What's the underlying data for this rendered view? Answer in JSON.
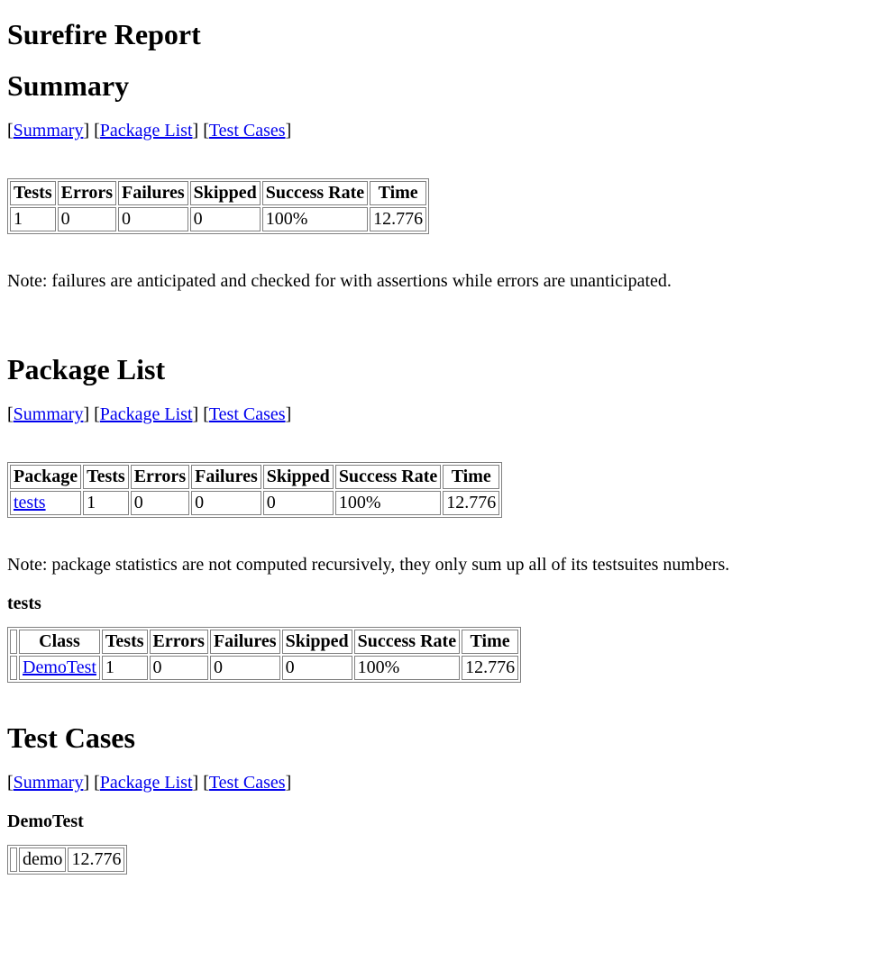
{
  "title": "Surefire Report",
  "sections": {
    "summary": "Summary",
    "packageList": "Package List",
    "testCases": "Test Cases"
  },
  "navLinks": {
    "summary": "Summary",
    "packageList": "Package List",
    "testCases": "Test Cases"
  },
  "summaryTable": {
    "headers": {
      "tests": "Tests",
      "errors": "Errors",
      "failures": "Failures",
      "skipped": "Skipped",
      "successRate": "Success Rate",
      "time": "Time"
    },
    "row": {
      "tests": "1",
      "errors": "0",
      "failures": "0",
      "skipped": "0",
      "successRate": "100%",
      "time": "12.776"
    }
  },
  "summaryNote": "Note: failures are anticipated and checked for with assertions while errors are unanticipated.",
  "packageTable": {
    "headers": {
      "package": "Package",
      "tests": "Tests",
      "errors": "Errors",
      "failures": "Failures",
      "skipped": "Skipped",
      "successRate": "Success Rate",
      "time": "Time"
    },
    "row": {
      "package": "tests",
      "tests": "1",
      "errors": "0",
      "failures": "0",
      "skipped": "0",
      "successRate": "100%",
      "time": "12.776"
    }
  },
  "packageNote": "Note: package statistics are not computed recursively, they only sum up all of its testsuites numbers.",
  "packageSubheading": "tests",
  "classTable": {
    "headers": {
      "blank": "",
      "class": "Class",
      "tests": "Tests",
      "errors": "Errors",
      "failures": "Failures",
      "skipped": "Skipped",
      "successRate": "Success Rate",
      "time": "Time"
    },
    "row": {
      "blank": "",
      "class": "DemoTest",
      "tests": "1",
      "errors": "0",
      "failures": "0",
      "skipped": "0",
      "successRate": "100%",
      "time": "12.776"
    }
  },
  "testCaseSubheading": "DemoTest",
  "testCaseTable": {
    "row": {
      "blank": "",
      "name": "demo",
      "time": "12.776"
    }
  }
}
